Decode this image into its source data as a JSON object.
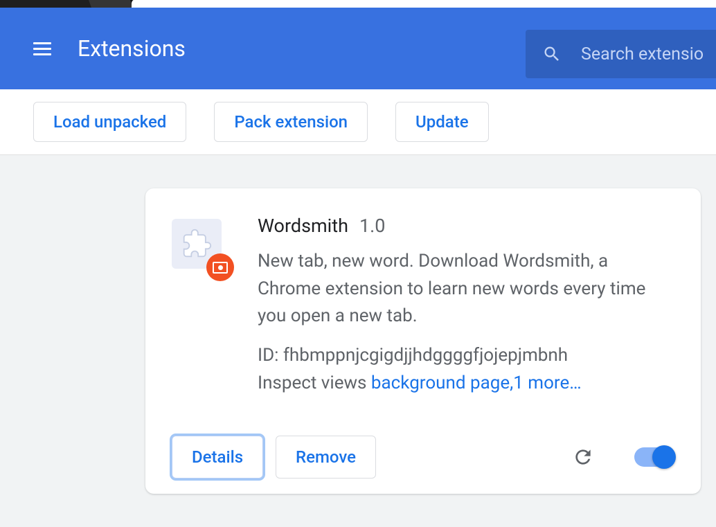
{
  "header": {
    "title": "Extensions",
    "search_placeholder": "Search extensio"
  },
  "toolbar": {
    "load_unpacked": "Load unpacked",
    "pack_extension": "Pack extension",
    "update": "Update"
  },
  "extension": {
    "name": "Wordsmith",
    "version": "1.0",
    "description": "New tab, new word. Download Wordsmith, a Chrome extension to learn new words every time you open a new tab.",
    "id_label": "ID: ",
    "id_value": "fhbmppnjcgigdjjhdggggfjojepjmbnh",
    "inspect_label": "Inspect views ",
    "inspect_link": "background page,1 more…",
    "details_label": "Details",
    "remove_label": "Remove",
    "enabled": true
  }
}
